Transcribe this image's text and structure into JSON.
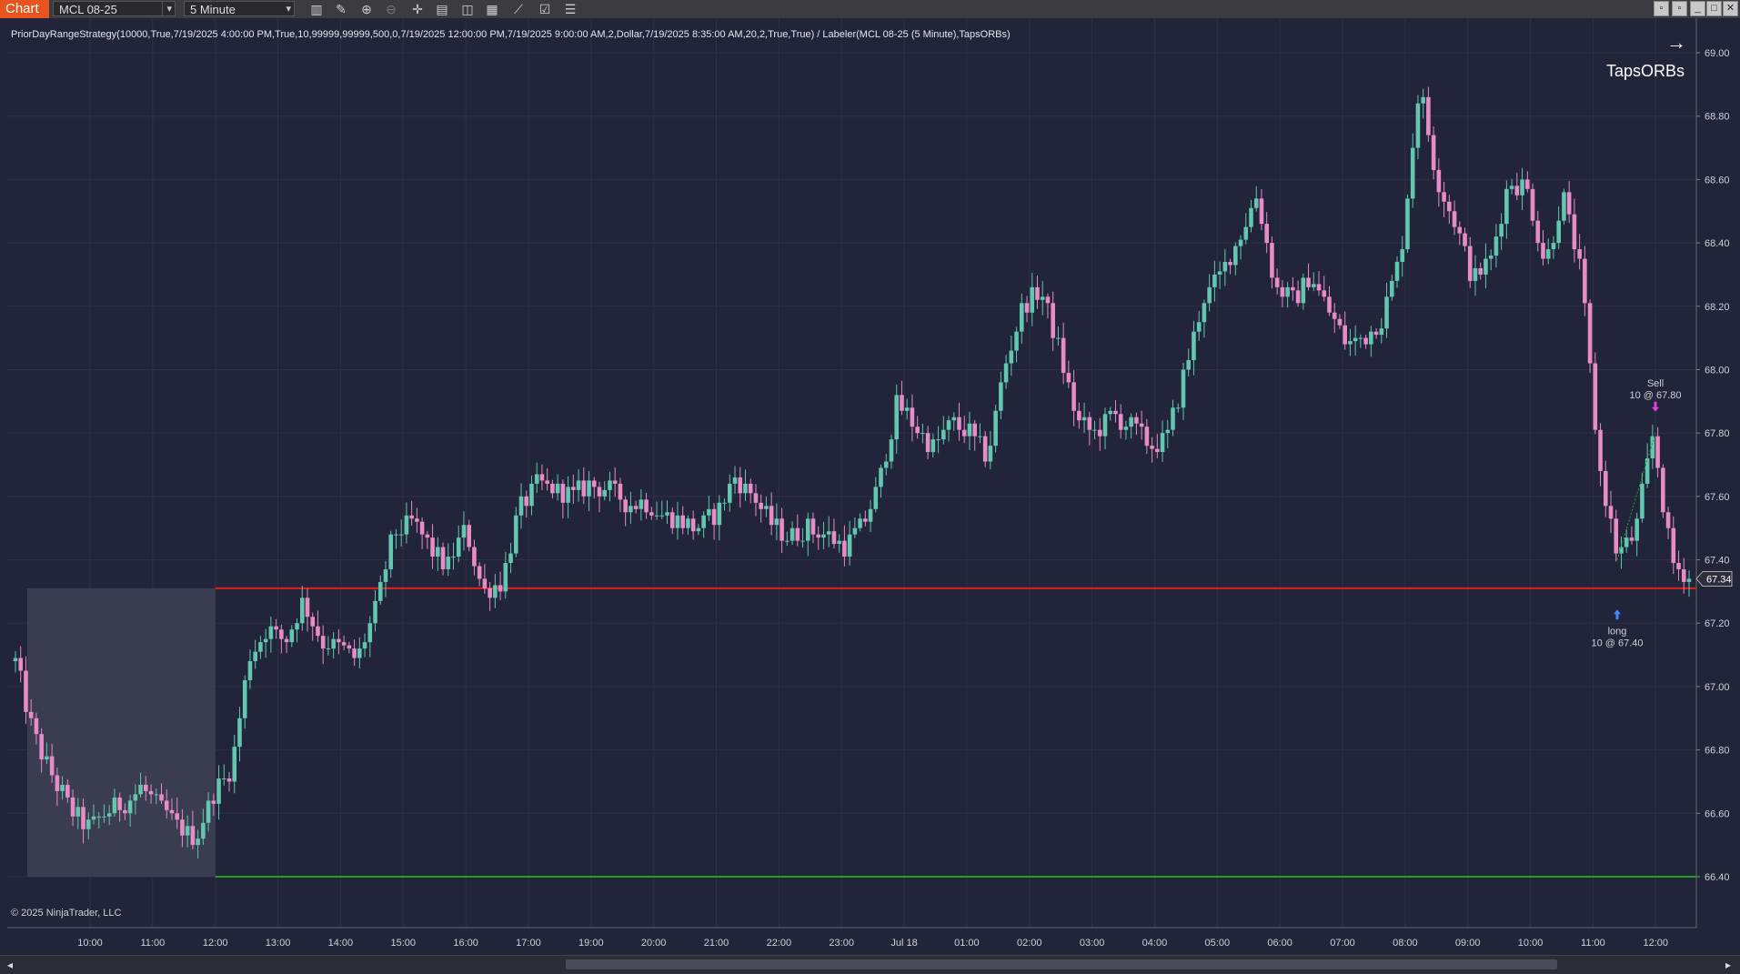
{
  "toolbar": {
    "tab_label": "Chart",
    "instrument": "MCL 08-25",
    "interval": "5 Minute",
    "icons": [
      "bar-type-icon",
      "draw-tool-icon",
      "zoom-in-icon",
      "zoom-out-icon",
      "crosshair-icon",
      "templates-icon",
      "properties-icon",
      "data-box-icon",
      "indicators-icon",
      "strategies-icon",
      "object-list-icon"
    ],
    "window_buttons": [
      "restore-icon",
      "minimize-icon",
      "maximize-icon",
      "close-icon"
    ]
  },
  "indicator_label": "PriorDayRangeStrategy(10000,True,7/19/2025 4:00:00 PM,True,10,99999,99999,500,0,7/19/2025 12:00:00 PM,7/19/2025 9:00:00 AM,2,Dollar,7/19/2025 8:35:00 AM,20,2,True,True) / Labeler(MCL 08-25 (5 Minute),TapsORBs)",
  "labeler_text": "TapsORBs",
  "copyright": "© 2025 NinjaTrader, LLC",
  "chart_data": {
    "type": "candlestick",
    "instrument": "MCL 08-25",
    "interval": "5 Minute",
    "ylim": [
      66.25,
      69.05
    ],
    "y_ticks": [
      "69.00",
      "68.80",
      "68.60",
      "68.40",
      "68.20",
      "68.00",
      "67.80",
      "67.60",
      "67.40",
      "67.20",
      "67.00",
      "66.80",
      "66.60",
      "66.40"
    ],
    "x_ticks": [
      "10:00",
      "11:00",
      "12:00",
      "13:00",
      "14:00",
      "15:00",
      "16:00",
      "17:00",
      "19:00",
      "20:00",
      "21:00",
      "22:00",
      "23:00",
      "Jul 18",
      "01:00",
      "02:00",
      "03:00",
      "04:00",
      "05:00",
      "06:00",
      "07:00",
      "08:00",
      "09:00",
      "10:00",
      "11:00",
      "12:00"
    ],
    "price_path": [
      67.08,
      66.85,
      66.72,
      66.62,
      66.55,
      66.6,
      66.63,
      66.68,
      66.62,
      66.56,
      66.52,
      66.66,
      66.74,
      67.1,
      67.18,
      67.14,
      67.27,
      67.14,
      67.12,
      67.09,
      67.24,
      67.48,
      67.52,
      67.44,
      67.38,
      67.5,
      67.3,
      67.33,
      67.56,
      67.64,
      67.62,
      67.6,
      67.64,
      67.62,
      67.58,
      67.58,
      67.54,
      67.52,
      67.5,
      67.55,
      67.66,
      67.6,
      67.52,
      67.47,
      67.5,
      67.48,
      67.44,
      67.5,
      67.64,
      67.9,
      67.82,
      67.76,
      67.83,
      67.8,
      67.72,
      68.02,
      68.2,
      68.25,
      68.06,
      67.84,
      67.8,
      67.86,
      67.82,
      67.76,
      67.78,
      68.0,
      68.22,
      68.3,
      68.42,
      68.55,
      68.26,
      68.22,
      68.3,
      68.18,
      68.08,
      68.1,
      68.17,
      68.37,
      68.9,
      68.6,
      68.47,
      68.28,
      68.35,
      68.6,
      68.57,
      68.33,
      68.55,
      68.3,
      67.7,
      67.42,
      67.48,
      67.8,
      67.4,
      67.34
    ],
    "last_price": "67.34",
    "horizontal_lines": [
      {
        "name": "prior-day-high",
        "value": 67.31,
        "color": "#e02020"
      },
      {
        "name": "prior-day-low",
        "value": 66.4,
        "color": "#22a022"
      }
    ],
    "opening_range_box": {
      "x_start_label": "09:35",
      "x_end_label": "12:00",
      "low": 66.4,
      "high": 67.31
    },
    "trades": [
      {
        "side": "long",
        "label": "long",
        "detail": "10 @ 67.40",
        "price": 67.4
      },
      {
        "side": "sell",
        "label": "Sell",
        "detail": "10 @ 67.80",
        "price": 67.8
      }
    ],
    "grid": true,
    "colors": {
      "up": "#62c6b0",
      "down": "#e78cc4",
      "background": "#22243a",
      "grid": "#2e3046",
      "axis_text": "#d0d0d8"
    }
  }
}
